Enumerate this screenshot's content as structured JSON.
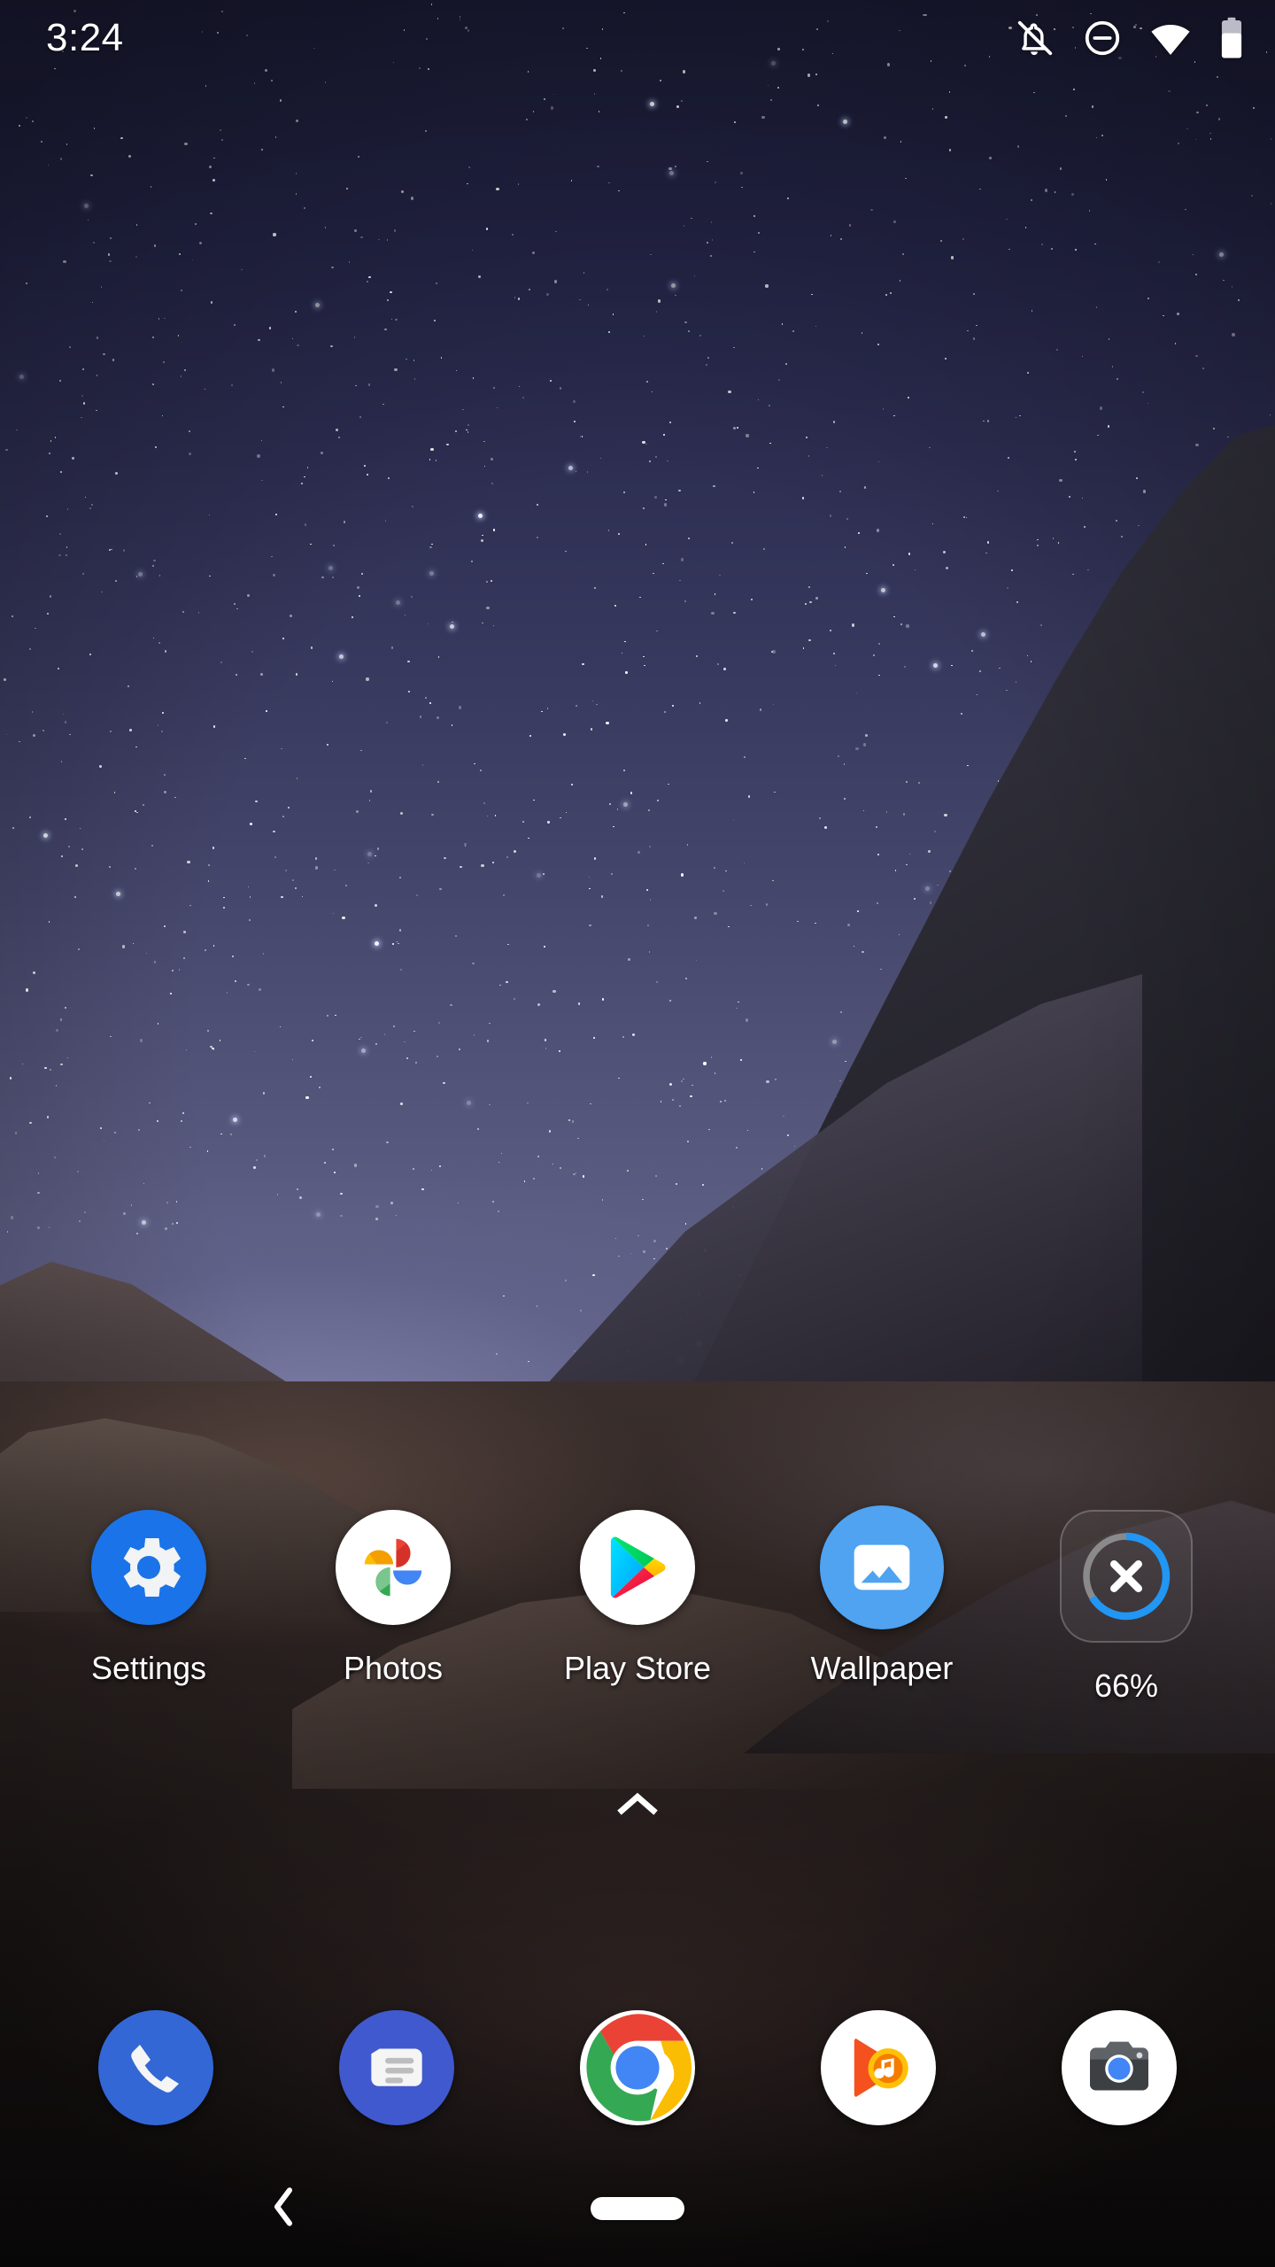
{
  "statusbar": {
    "clock": "3:24",
    "icons": [
      {
        "name": "notifications-silenced-icon",
        "label": "Notifications silenced"
      },
      {
        "name": "do-not-disturb-icon",
        "label": "Do not disturb"
      },
      {
        "name": "wifi-icon",
        "label": "Wi-Fi full signal"
      },
      {
        "name": "battery-icon",
        "label": "Battery"
      }
    ]
  },
  "homescreen": {
    "apps": [
      {
        "label": "Settings",
        "icon": "settings-gear-icon"
      },
      {
        "label": "Photos",
        "icon": "google-photos-icon"
      },
      {
        "label": "Play Store",
        "icon": "play-store-icon"
      },
      {
        "label": "Wallpaper",
        "icon": "wallpaper-picture-icon"
      },
      {
        "label": "66%",
        "icon": "download-progress-icon"
      }
    ],
    "download": {
      "percent_label": "66%",
      "percent_value": 66,
      "cancel_icon": "close-x-icon",
      "progress_color": "#2196F3",
      "track_color": "#8a8a8a"
    },
    "drawer_handle": {
      "icon": "chevron-up-icon"
    }
  },
  "dock": {
    "apps": [
      {
        "name": "phone",
        "icon": "phone-icon"
      },
      {
        "name": "messages",
        "icon": "messages-icon"
      },
      {
        "name": "chrome",
        "icon": "chrome-icon"
      },
      {
        "name": "play-music",
        "icon": "play-music-icon"
      },
      {
        "name": "camera",
        "icon": "camera-icon"
      }
    ]
  },
  "navbar": {
    "back": {
      "icon": "back-chevron-icon"
    },
    "home": {
      "icon": "home-pill-icon"
    }
  },
  "colors": {
    "accent_blue": "#2196F3",
    "settings_blue": "#1A73E8",
    "wallpaper_blue": "#4FA3F0",
    "phone_blue": "#3367D6",
    "messages_blue": "#4059CE",
    "label_white": "#FFFFFF"
  }
}
